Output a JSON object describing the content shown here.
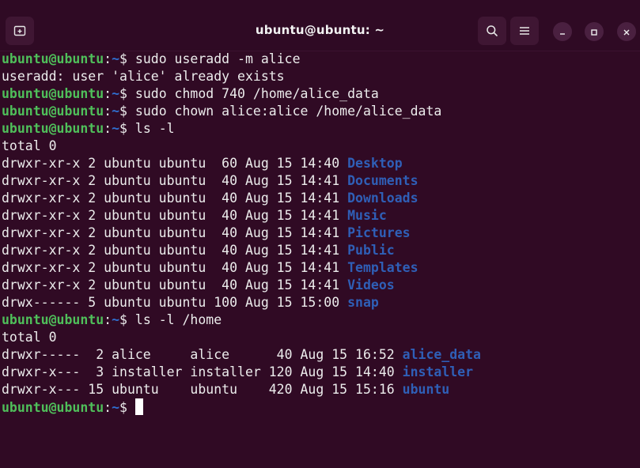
{
  "window": {
    "title": "ubuntu@ubuntu: ~",
    "bg_color": "#300a24",
    "titlebar_color": "#2f0a24",
    "buttons": {
      "new_tab_icon": "new-tab-icon",
      "search_icon": "search-icon",
      "menu_icon": "hamburger-menu-icon",
      "minimize_icon": "minimize-icon",
      "maximize_icon": "maximize-icon",
      "close_icon": "close-icon"
    }
  },
  "prompt": {
    "user": "ubuntu@ubuntu",
    "sep": ":",
    "path": "~",
    "symbol": "$ "
  },
  "colors": {
    "prompt_user": "#4fbf5a",
    "prompt_path": "#2f6fd0",
    "directory": "#2f5fb7",
    "text": "#ececec"
  },
  "lines": [
    {
      "type": "prompt",
      "cmd": "sudo useradd -m alice"
    },
    {
      "type": "output",
      "text": "useradd: user 'alice' already exists"
    },
    {
      "type": "prompt",
      "cmd": "sudo chmod 740 /home/alice_data"
    },
    {
      "type": "prompt",
      "cmd": "sudo chown alice:alice /home/alice_data"
    },
    {
      "type": "prompt",
      "cmd": "ls -l"
    },
    {
      "type": "output",
      "text": "total 0"
    },
    {
      "type": "ls",
      "meta": "drwxr-xr-x 2 ubuntu ubuntu  60 Aug 15 14:40 ",
      "name": "Desktop"
    },
    {
      "type": "ls",
      "meta": "drwxr-xr-x 2 ubuntu ubuntu  40 Aug 15 14:41 ",
      "name": "Documents"
    },
    {
      "type": "ls",
      "meta": "drwxr-xr-x 2 ubuntu ubuntu  40 Aug 15 14:41 ",
      "name": "Downloads"
    },
    {
      "type": "ls",
      "meta": "drwxr-xr-x 2 ubuntu ubuntu  40 Aug 15 14:41 ",
      "name": "Music"
    },
    {
      "type": "ls",
      "meta": "drwxr-xr-x 2 ubuntu ubuntu  40 Aug 15 14:41 ",
      "name": "Pictures"
    },
    {
      "type": "ls",
      "meta": "drwxr-xr-x 2 ubuntu ubuntu  40 Aug 15 14:41 ",
      "name": "Public"
    },
    {
      "type": "ls",
      "meta": "drwxr-xr-x 2 ubuntu ubuntu  40 Aug 15 14:41 ",
      "name": "Templates"
    },
    {
      "type": "ls",
      "meta": "drwxr-xr-x 2 ubuntu ubuntu  40 Aug 15 14:41 ",
      "name": "Videos"
    },
    {
      "type": "ls",
      "meta": "drwx------ 5 ubuntu ubuntu 100 Aug 15 15:00 ",
      "name": "snap"
    },
    {
      "type": "prompt",
      "cmd": "ls -l /home"
    },
    {
      "type": "output",
      "text": "total 0"
    },
    {
      "type": "ls",
      "meta": "drwxr-----  2 alice     alice      40 Aug 15 16:52 ",
      "name": "alice_data"
    },
    {
      "type": "ls",
      "meta": "drwxr-x---  3 installer installer 120 Aug 15 14:40 ",
      "name": "installer"
    },
    {
      "type": "ls",
      "meta": "drwxr-x--- 15 ubuntu    ubuntu    420 Aug 15 15:16 ",
      "name": "ubuntu"
    },
    {
      "type": "prompt",
      "cmd": "",
      "cursor": true
    }
  ]
}
